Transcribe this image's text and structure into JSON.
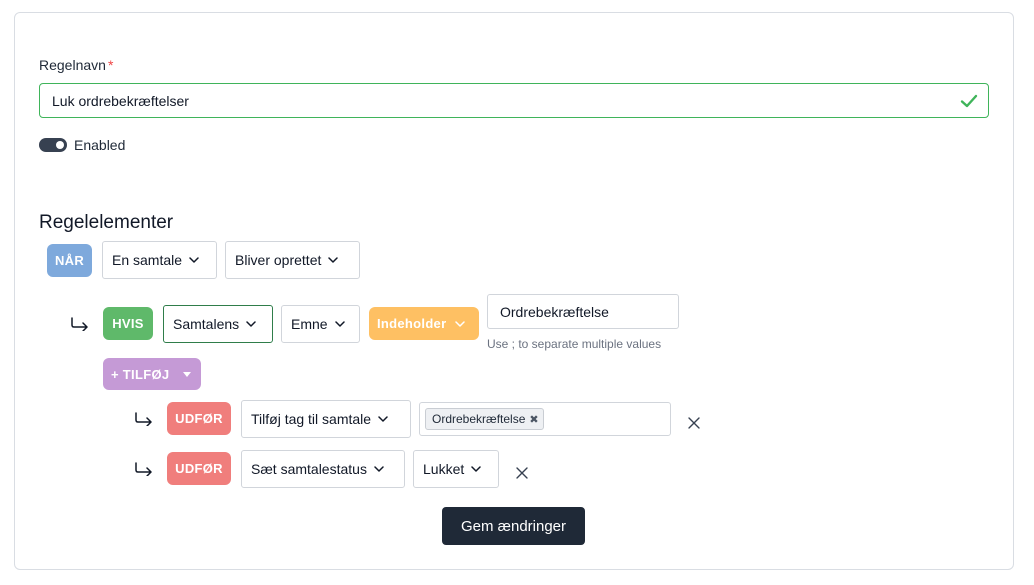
{
  "form": {
    "rule_name_label": "Regelnavn",
    "required_mark": "*",
    "rule_name_value": "Luk ordrebekræftelser",
    "enabled_label": "Enabled",
    "enabled": true
  },
  "rule_elements": {
    "title": "Regelelementer",
    "when": {
      "badge": "NÅR",
      "subject": "En samtale",
      "event": "Bliver oprettet"
    },
    "if": {
      "badge": "HVIS",
      "field": "Samtalens",
      "property": "Emne",
      "operator": "Indeholder",
      "value": "Ordrebekræftelse",
      "hint": "Use ; to separate multiple values"
    },
    "add": {
      "label": "+ TILFØJ"
    },
    "actions": [
      {
        "badge": "UDFØR",
        "action": "Tilføj tag til samtale",
        "tags": [
          "Ordrebekræftelse"
        ],
        "tag_remove": "✖"
      },
      {
        "badge": "UDFØR",
        "action": "Sæt samtalestatus",
        "value": "Lukket"
      }
    ]
  },
  "save_label": "Gem ændringer",
  "colors": {
    "when": "#7ea9dc",
    "if": "#5fb96a",
    "operator": "#fec063",
    "add": "#c59ad6",
    "action": "#f07e7c",
    "valid": "#3fb45a",
    "primary_button": "#1f2937"
  }
}
